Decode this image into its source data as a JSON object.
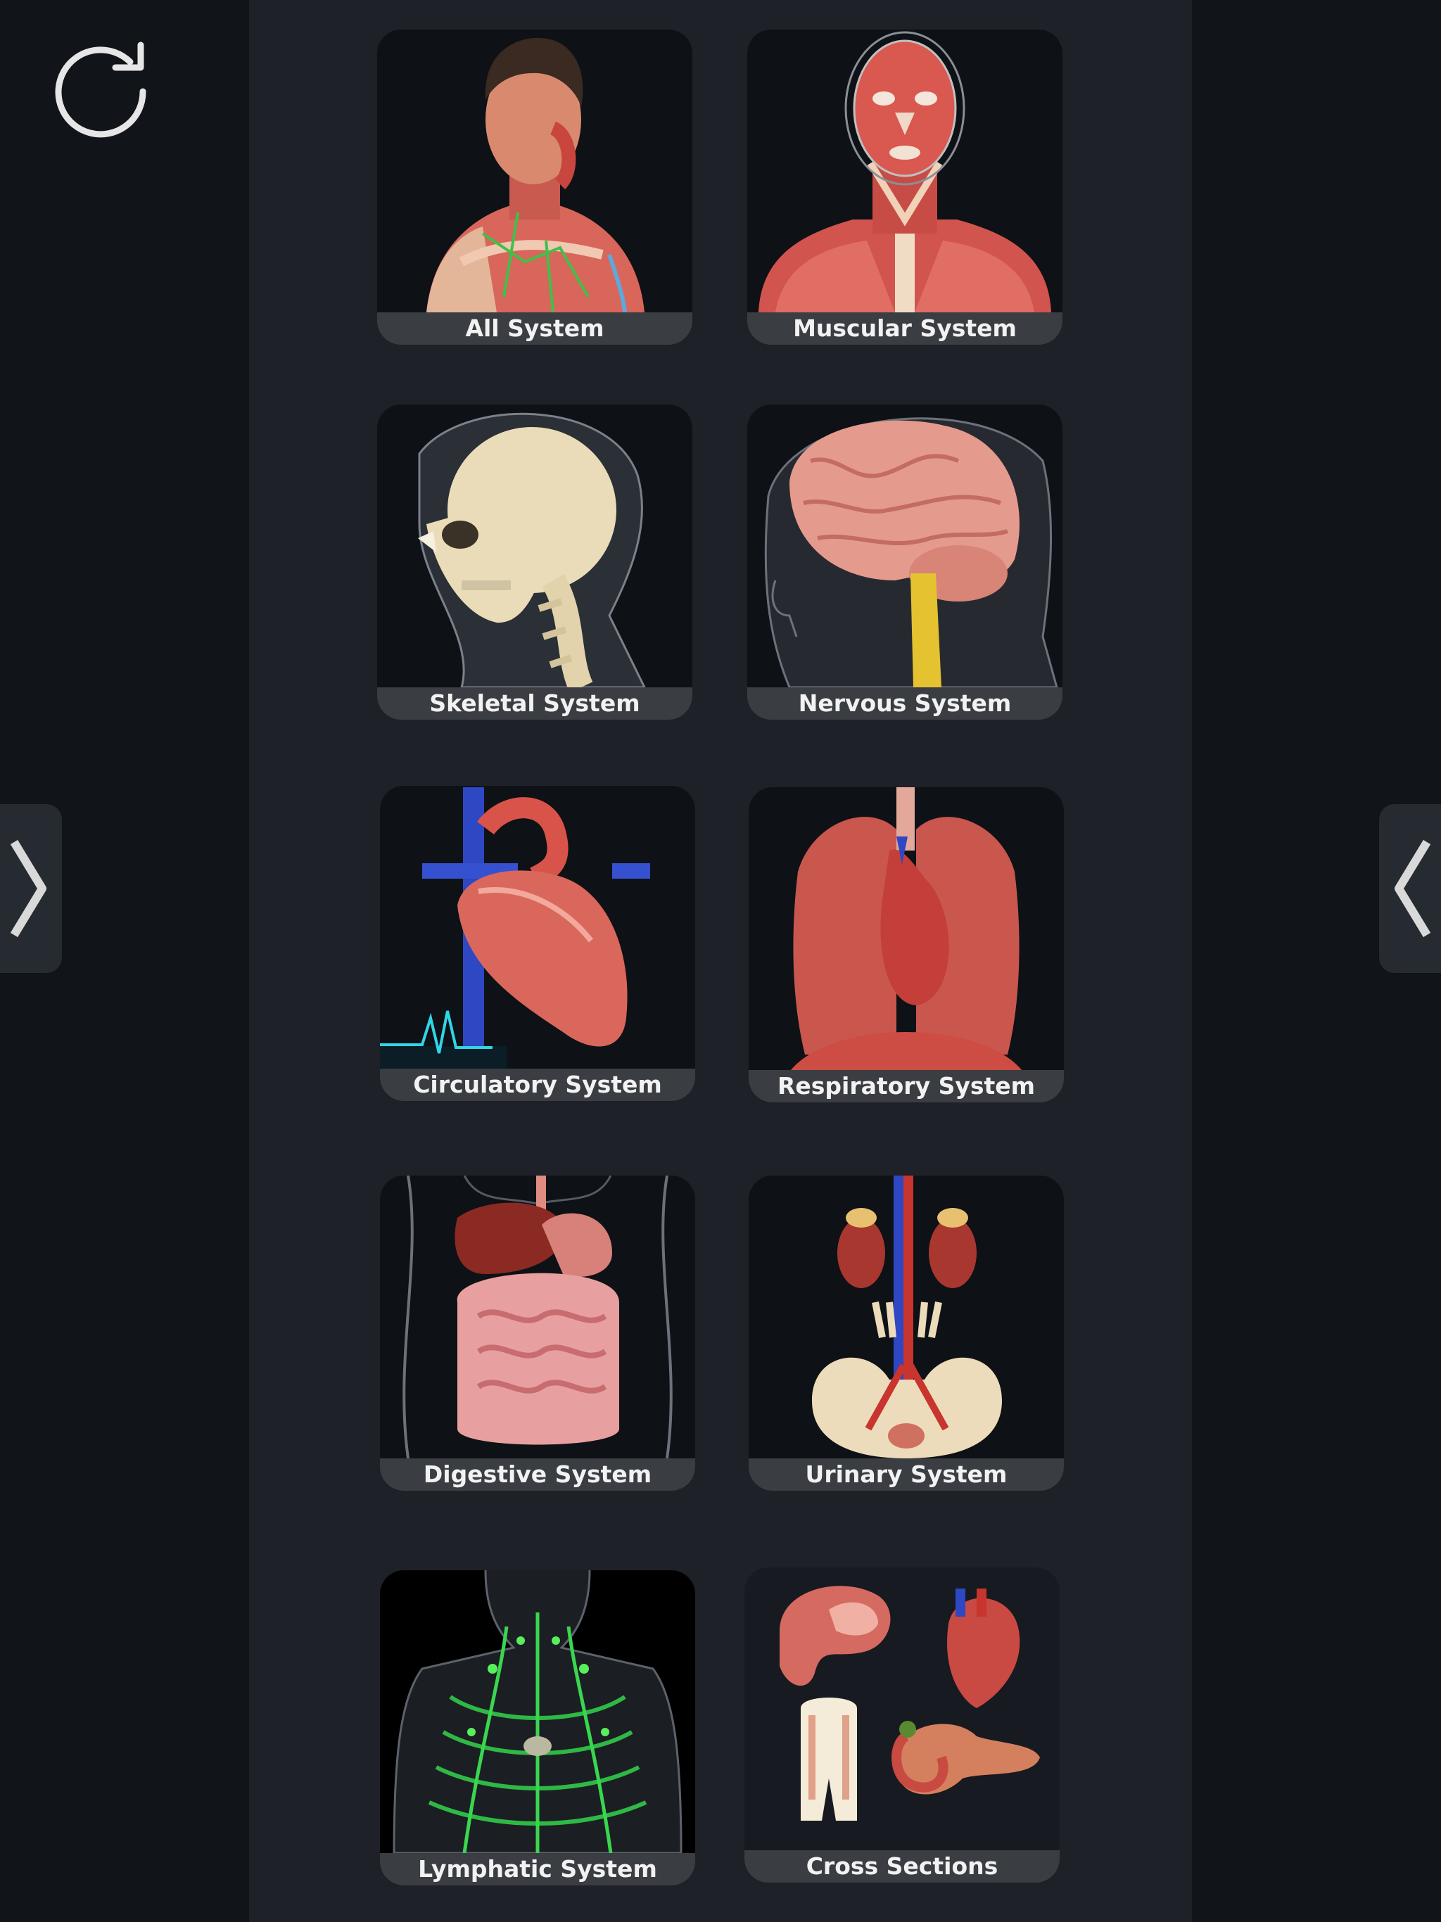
{
  "toolbar": {
    "refresh_icon": "refresh-icon"
  },
  "navigation": {
    "prev_icon": "chevron-right-icon",
    "next_icon": "chevron-left-icon"
  },
  "systems": [
    {
      "id": "all",
      "label": "All System"
    },
    {
      "id": "muscular",
      "label": "Muscular System"
    },
    {
      "id": "skeletal",
      "label": "Skeletal System"
    },
    {
      "id": "nervous",
      "label": "Nervous System"
    },
    {
      "id": "circulatory",
      "label": "Circulatory System"
    },
    {
      "id": "respiratory",
      "label": "Respiratory System"
    },
    {
      "id": "digestive",
      "label": "Digestive System"
    },
    {
      "id": "urinary",
      "label": "Urinary System"
    },
    {
      "id": "lymphatic",
      "label": "Lymphatic System"
    },
    {
      "id": "cross",
      "label": "Cross Sections"
    }
  ],
  "colors": {
    "background": "#111418",
    "panel": "#1e2128",
    "caption_bar": "#3a3d42",
    "caption_text": "#f2f2f2"
  }
}
